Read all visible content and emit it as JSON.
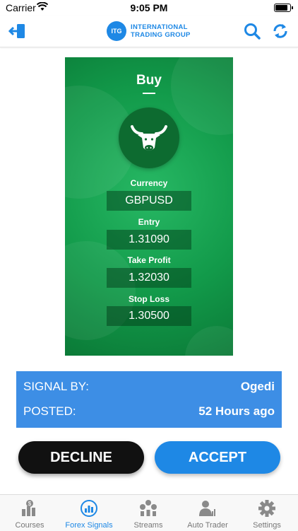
{
  "status_bar": {
    "carrier": "Carrier",
    "time": "9:05 PM",
    "battery_level": 0.95
  },
  "header": {
    "logo_mark": "ITG",
    "logo_line1": "INTERNATIONAL",
    "logo_line2": "TRADING GROUP"
  },
  "signal": {
    "direction": "Buy",
    "fields": [
      {
        "label": "Currency",
        "value": "GBPUSD"
      },
      {
        "label": "Entry",
        "value": "1.31090"
      },
      {
        "label": "Take Profit",
        "value": "1.32030"
      },
      {
        "label": "Stop Loss",
        "value": "1.30500"
      }
    ]
  },
  "info": {
    "signal_by_label": "SIGNAL BY:",
    "signal_by_value": "Ogedi",
    "posted_label": "POSTED:",
    "posted_value": "52 Hours ago"
  },
  "actions": {
    "decline": "DECLINE",
    "accept": "ACCEPT"
  },
  "tabs": [
    {
      "label": "Courses",
      "icon": "courses-icon",
      "active": false
    },
    {
      "label": "Forex Signals",
      "icon": "forex-signals-icon",
      "active": true
    },
    {
      "label": "Streams",
      "icon": "streams-icon",
      "active": false
    },
    {
      "label": "Auto Trader",
      "icon": "auto-trader-icon",
      "active": false
    },
    {
      "label": "Settings",
      "icon": "gear-icon",
      "active": false
    }
  ],
  "colors": {
    "accent": "#1e88e5",
    "card_green": "#129a4a",
    "info_blue": "#3d8ee5",
    "decline": "#111111"
  }
}
